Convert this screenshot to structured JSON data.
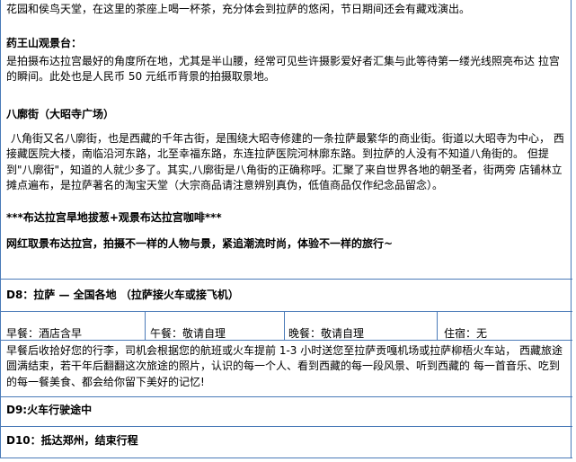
{
  "intro": {
    "line1": "花园和侯鸟天堂，在这里的茶座上喝一杯茶，充分体会到拉萨的悠闲，节日期间还会有藏戏演出。"
  },
  "yaowangshan": {
    "heading": "药王山观景台：",
    "para": "是拍摄布达拉宫最好的角度所在地，尤其是半山腰，经常可见些许摄影爱好者汇集与此等待第一缕光线照亮布达 拉宫的瞬间。此处也是人民币 50 元纸币背景的拍摄取景地。"
  },
  "barkhor": {
    "heading": "八廓街（大昭寺广场）",
    "para": "八角街又名八廓街，也是西藏的千年古街，是围绕大昭寺修建的一条拉萨最繁华的商业街。街道以大昭寺为中心， 西接藏医院大楼，南临沿河东路，北至幸福东路，东连拉萨医院河林廓东路。到拉萨的人没有不知道八角街的。 但提到\"八廓街\"，知道的人就少多了。其实,八廓街是八角街的正确称呼。汇聚了来自世界各地的朝圣者，街两旁 店铺林立摊点遍布，是拉萨著名的淘宝天堂（大宗商品请注意辨别真伪，低值商品仅作纪念品留念）。"
  },
  "slogan1": "***布达拉宫旱地拔葱+观景布达拉宫咖啡***",
  "slogan2": "网红取景布达拉宫，拍摄不一样的人物与景，紧追潮流时尚，体验不一样的旅行~",
  "day8": {
    "title": "D8：拉萨 — 全国各地 （拉萨接火车或接飞机）",
    "breakfast": "早餐：酒店含早",
    "lunch": "午餐：敬请自理",
    "dinner": "晚餐：敬请自理",
    "stay": "住宿：无",
    "desc": "早餐后收拾好您的行李，司机会根据您的航班或火车提前 1-3 小时送您至拉萨贡嘎机场或拉萨柳梧火车站， 西藏旅途圆满结束，若干年后翻翻这次旅途的照片，认识的每一个人、看到西藏的每一段风景、听到西藏的 每一首音乐、吃到的每一餐美食、都会给你留下美好的记忆!"
  },
  "day9": {
    "title": "D9:火车行驶途中"
  },
  "day10": {
    "title": "D10：抵达郑州，结束行程"
  }
}
